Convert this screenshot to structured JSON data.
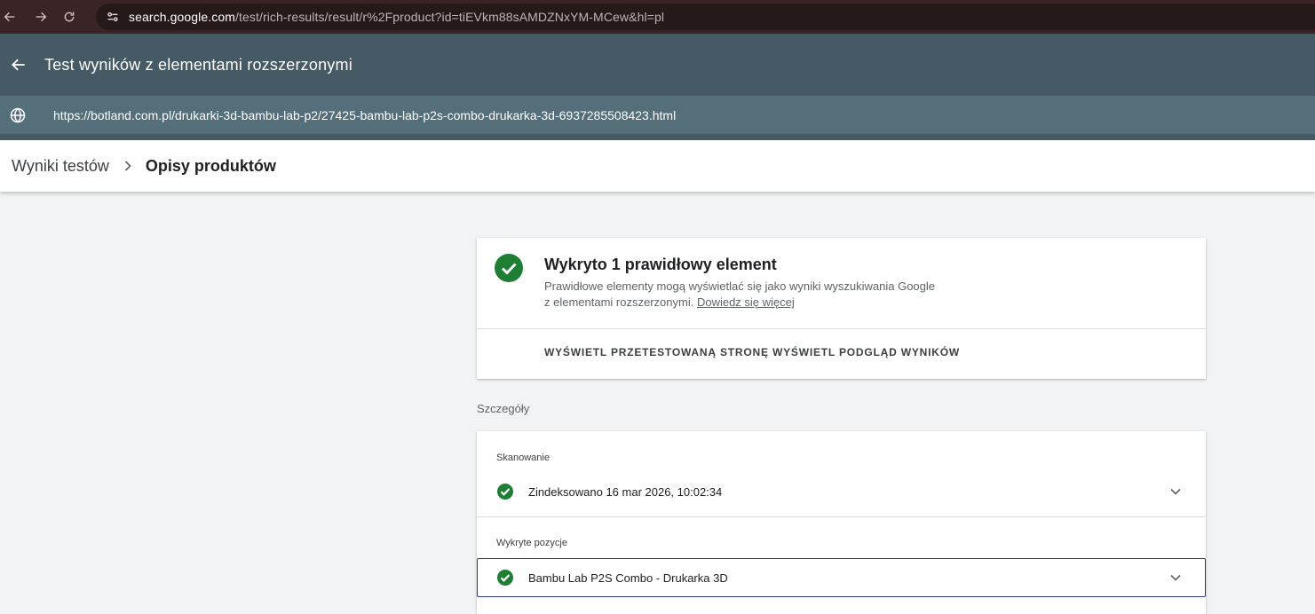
{
  "browser": {
    "url_host": "search.google.com",
    "url_path": "/test/rich-results/result/r%2Fproduct?id=tiEVkm88sAMDZNxYM-MCew&hl=pl",
    "icons": [
      "arrow-back-icon",
      "arrow-forward-icon",
      "reload-icon",
      "site-settings-icon"
    ]
  },
  "header": {
    "title": "Test wyników z elementami rozszerzonymi",
    "tested_url": "https://botland.com.pl/drukarki-3d-bambu-lab-p2/27425-bambu-lab-p2s-combo-drukarka-3d-6937285508423.html"
  },
  "breadcrumb": {
    "parent": "Wyniki testów",
    "current": "Opisy produktów"
  },
  "summary": {
    "title": "Wykryto 1 prawidłowy element",
    "desc_line1": "Prawidłowe elementy mogą wyświetlać się jako wyniki wyszukiwania Google",
    "desc_line2": "z elementami rozszerzonymi.",
    "learn_more": "Dowiedz się więcej",
    "action_tested_page": "WYŚWIETL PRZETESTOWANĄ STRONĘ",
    "action_preview": "WYŚWIETL PODGLĄD WYNIKÓW"
  },
  "details": {
    "section_label": "Szczegóły",
    "crawl_label": "Skanowanie",
    "crawl_status": "Zindeksowano 16 mar 2026, 10:02:34",
    "detected_label": "Wykryte pozycje",
    "detected_item": "Bambu Lab P2S Combo - Drukarka 3D"
  },
  "colors": {
    "browser_bar": "#3b2426",
    "header": "#455a64",
    "url_row": "#546e7a",
    "success_green": "#1e8e3e",
    "selected_border": "#2f3a8f"
  }
}
